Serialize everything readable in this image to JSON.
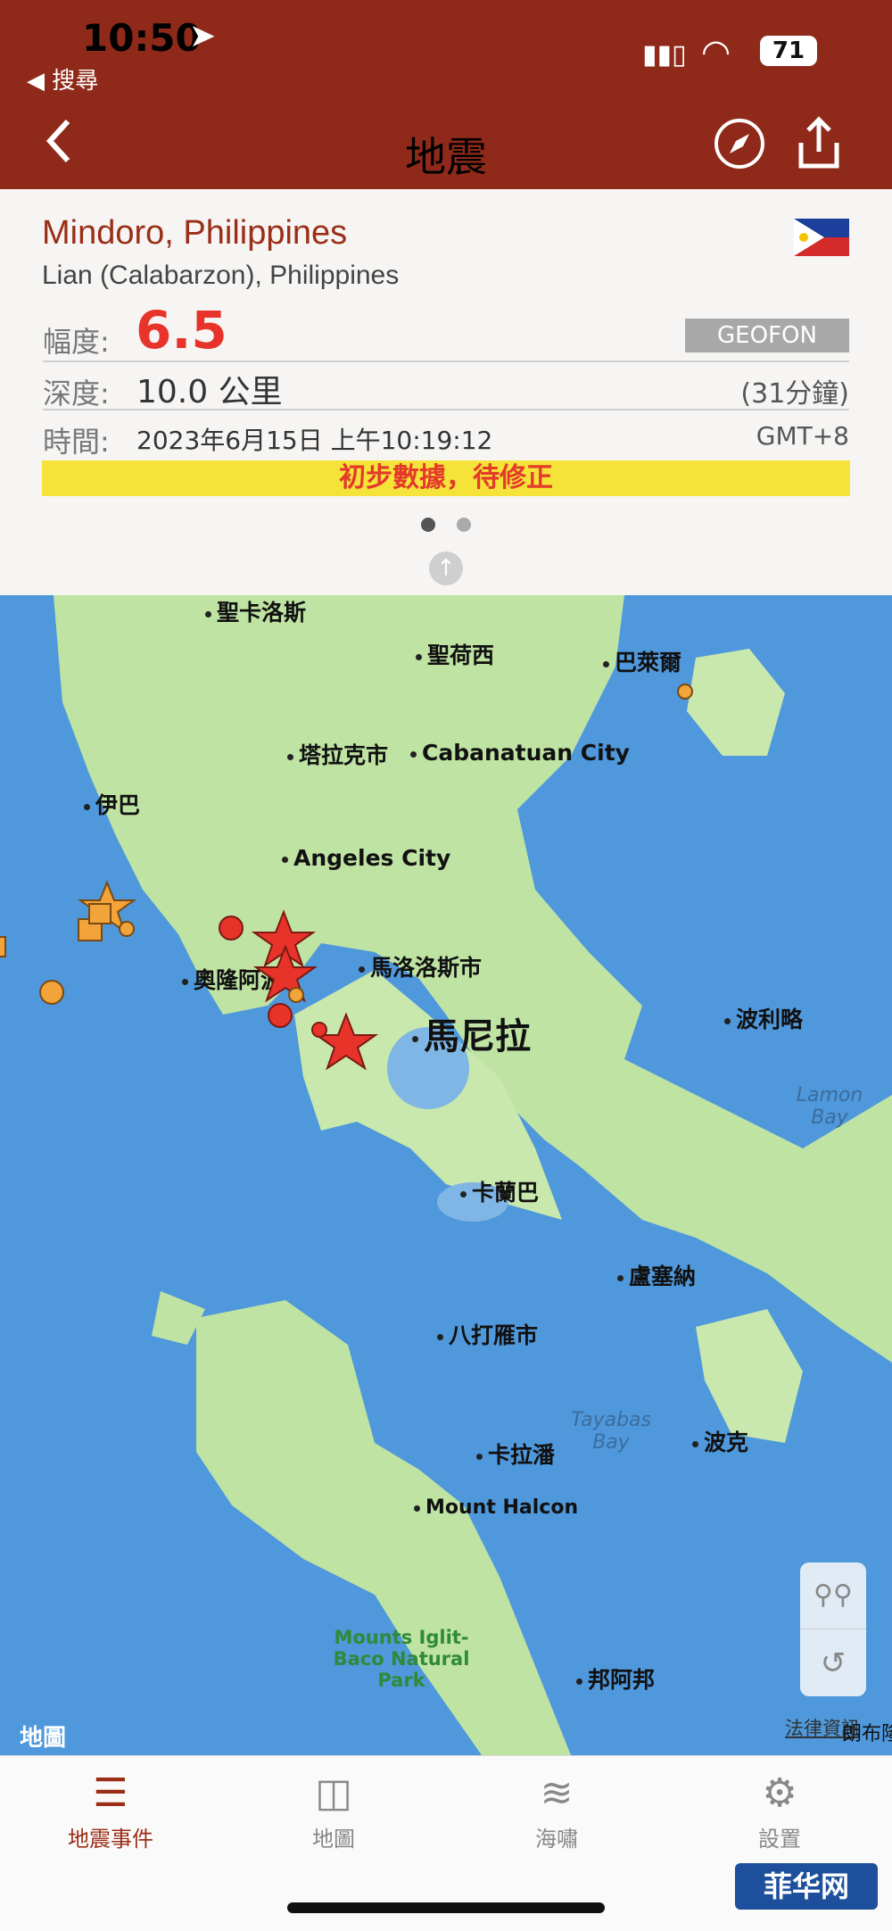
{
  "status": {
    "time": "10:50",
    "back_app": "◀ 搜尋",
    "battery": "71"
  },
  "nav": {
    "title": "地震",
    "back_icon": "chevron-left-icon",
    "compass_icon": "compass-icon",
    "share_icon": "share-icon"
  },
  "quake": {
    "place": "Mindoro, Philippines",
    "sub_place": "Lian (Calabarzon), Philippines",
    "mag_label": "幅度:",
    "mag_value": "6.5",
    "source": "GEOFON",
    "depth_label": "深度:",
    "depth_value": "10.0 公里",
    "depth_ago": "(31分鐘)",
    "time_label": "時間:",
    "time_value": "2023年6月15日 上午10:19:12",
    "timezone": "GMT+8",
    "notice": "初步數據，待修正"
  },
  "map": {
    "cities": [
      {
        "name": "聖卡洛斯"
      },
      {
        "name": "聖荷西"
      },
      {
        "name": "巴萊爾"
      },
      {
        "name": "塔拉克市"
      },
      {
        "name": "Cabanatuan City"
      },
      {
        "name": "伊巴"
      },
      {
        "name": "Angeles City"
      },
      {
        "name": "奧隆阿波"
      },
      {
        "name": "馬洛洛斯市"
      },
      {
        "name": "波利略"
      },
      {
        "name": "馬尼拉"
      },
      {
        "name": "卡蘭巴"
      },
      {
        "name": "盧塞納"
      },
      {
        "name": "八打雁市"
      },
      {
        "name": "卡拉潘"
      },
      {
        "name": "波克"
      },
      {
        "name": "Mount Halcon"
      },
      {
        "name": "邦阿邦"
      }
    ],
    "water_labels": [
      "Lamon Bay",
      "Tayabas Bay"
    ],
    "park_label": "Mounts Iglit-Baco Natural Park",
    "attribution": "地圖",
    "legal": "法律資訊",
    "edge_label": "朗布隆"
  },
  "tabs": [
    {
      "label": "地震事件",
      "icon": "list-icon"
    },
    {
      "label": "地圖",
      "icon": "map-icon"
    },
    {
      "label": "海嘯",
      "icon": "waves-icon"
    },
    {
      "label": "設置",
      "icon": "gear-icon"
    }
  ],
  "colors": {
    "header": "#8f2a1a",
    "accent": "#9a2e16",
    "magnitude": "#e8332a",
    "notice_bg": "#f5e33a"
  },
  "watermark": "菲华网"
}
